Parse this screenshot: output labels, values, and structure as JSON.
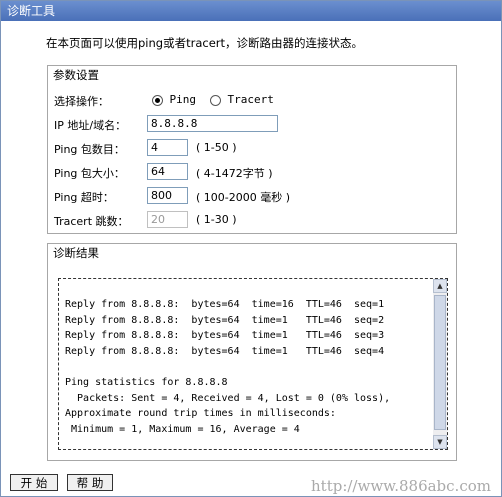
{
  "window": {
    "title": "诊断工具"
  },
  "intro_text": "在本页面可以使用ping或者tracert，诊断路由器的连接状态。",
  "params": {
    "legend": "参数设置",
    "operation_label": "选择操作：",
    "radio_ping_label": "Ping",
    "radio_tracert_label": "Tracert",
    "selected_operation": "Ping",
    "ip_label": "IP 地址/域名：",
    "ip_value": "8.8.8.8",
    "ping_count_label": "Ping 包数目：",
    "ping_count_value": "4",
    "ping_count_hint": "( 1-50 )",
    "ping_size_label": "Ping 包大小：",
    "ping_size_value": "64",
    "ping_size_hint": "( 4-1472字节 )",
    "ping_timeout_label": "Ping 超时：",
    "ping_timeout_value": "800",
    "ping_timeout_hint": "( 100-2000 毫秒 )",
    "tracert_hops_label": "Tracert 跳数：",
    "tracert_hops_value": "20",
    "tracert_hops_hint": "( 1-30 )"
  },
  "results": {
    "legend": "诊断结果",
    "lines": [
      "Reply from 8.8.8.8:  bytes=64  time=16  TTL=46  seq=1",
      "Reply from 8.8.8.8:  bytes=64  time=1   TTL=46  seq=2",
      "Reply from 8.8.8.8:  bytes=64  time=1   TTL=46  seq=3",
      "Reply from 8.8.8.8:  bytes=64  time=1   TTL=46  seq=4",
      "",
      "Ping statistics for 8.8.8.8",
      "  Packets: Sent = 4, Received = 4, Lost = 0 (0% loss),",
      "Approximate round trip times in milliseconds:",
      " Minimum = 1, Maximum = 16, Average = 4"
    ]
  },
  "buttons": {
    "start": "开 始",
    "help": "帮 助"
  },
  "watermark": "http://www.886abc.com"
}
